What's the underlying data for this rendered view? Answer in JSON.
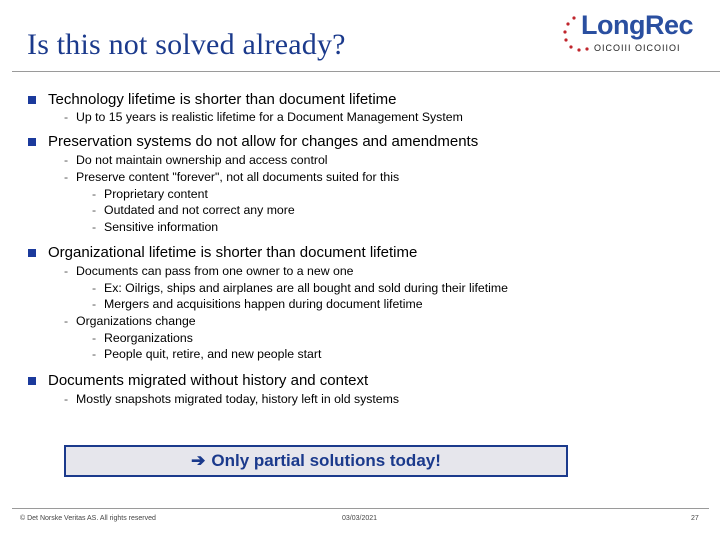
{
  "slide": {
    "title": "Is this not solved already?",
    "logo": {
      "name": "LongRec",
      "binary": "OICOIII OICOIIOI"
    },
    "bullets": [
      {
        "text": "Technology lifetime is shorter than document lifetime",
        "children": [
          {
            "text": "Up to 15 years is realistic lifetime for a Document Management System",
            "children": []
          }
        ]
      },
      {
        "text": "Preservation systems do not allow for changes and amendments",
        "children": [
          {
            "text": "Do not maintain ownership and access control",
            "children": []
          },
          {
            "text": "Preserve content \"forever\", not all documents suited for this",
            "children": [
              {
                "text": "Proprietary content"
              },
              {
                "text": "Outdated and not correct any more"
              },
              {
                "text": "Sensitive information"
              }
            ]
          }
        ]
      },
      {
        "text": "Organizational lifetime is shorter than document lifetime",
        "children": [
          {
            "text": "Documents can pass from one owner to a new one",
            "children": [
              {
                "text": "Ex: Oilrigs, ships and airplanes are all bought and sold during their lifetime"
              },
              {
                "text": "Mergers and acquisitions happen during document lifetime"
              }
            ]
          },
          {
            "text": "Organizations change",
            "children": [
              {
                "text": "Reorganizations"
              },
              {
                "text": "People quit, retire, and new people start"
              }
            ]
          }
        ]
      },
      {
        "text": "Documents migrated without history and context",
        "children": [
          {
            "text": "Mostly snapshots migrated today, history left in old systems",
            "children": []
          }
        ]
      }
    ],
    "callout": {
      "icon": "right-arrow-icon",
      "arrow_glyph": "➔",
      "text": "Only partial solutions today!"
    },
    "footer": {
      "copyright": "© Det Norske Veritas AS. All rights reserved",
      "date": "03/03/2021",
      "page_number": "27"
    }
  },
  "colors": {
    "title": "#1b3a8c",
    "bullet": "#1b3a9c",
    "callout_bg": "#e6e6ec",
    "callout_border": "#1b3a8c",
    "logo_text": "#2a4fa0",
    "logo_dots": "#c0262d"
  }
}
